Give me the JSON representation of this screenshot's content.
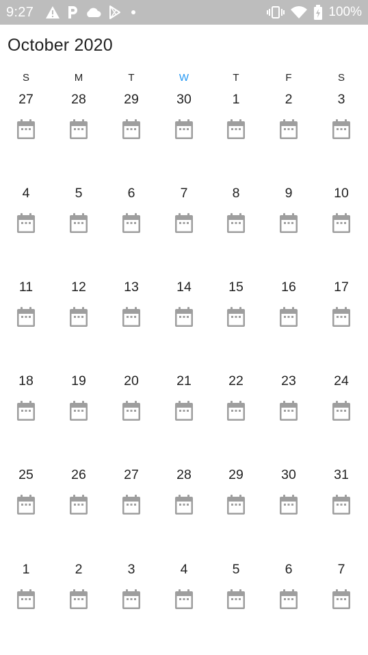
{
  "status_bar": {
    "time": "9:27",
    "battery_text": "100%",
    "left_icons": [
      "alert-icon",
      "p-icon",
      "cloud-icon",
      "play-store-icon",
      "dot-icon"
    ],
    "right_icons": [
      "vibrate-icon",
      "wifi-icon",
      "battery-icon"
    ]
  },
  "calendar": {
    "month_title": "October 2020",
    "weekdays": [
      "S",
      "M",
      "T",
      "W",
      "T",
      "F",
      "S"
    ],
    "today_weekday_index": 3,
    "accent_color": "#2196f3",
    "weeks": [
      [
        "27",
        "28",
        "29",
        "30",
        "1",
        "2",
        "3"
      ],
      [
        "4",
        "5",
        "6",
        "7",
        "8",
        "9",
        "10"
      ],
      [
        "11",
        "12",
        "13",
        "14",
        "15",
        "16",
        "17"
      ],
      [
        "18",
        "19",
        "20",
        "21",
        "22",
        "23",
        "24"
      ],
      [
        "25",
        "26",
        "27",
        "28",
        "29",
        "30",
        "31"
      ],
      [
        "1",
        "2",
        "3",
        "4",
        "5",
        "6",
        "7"
      ]
    ],
    "day_icon": "calendar-icon"
  }
}
